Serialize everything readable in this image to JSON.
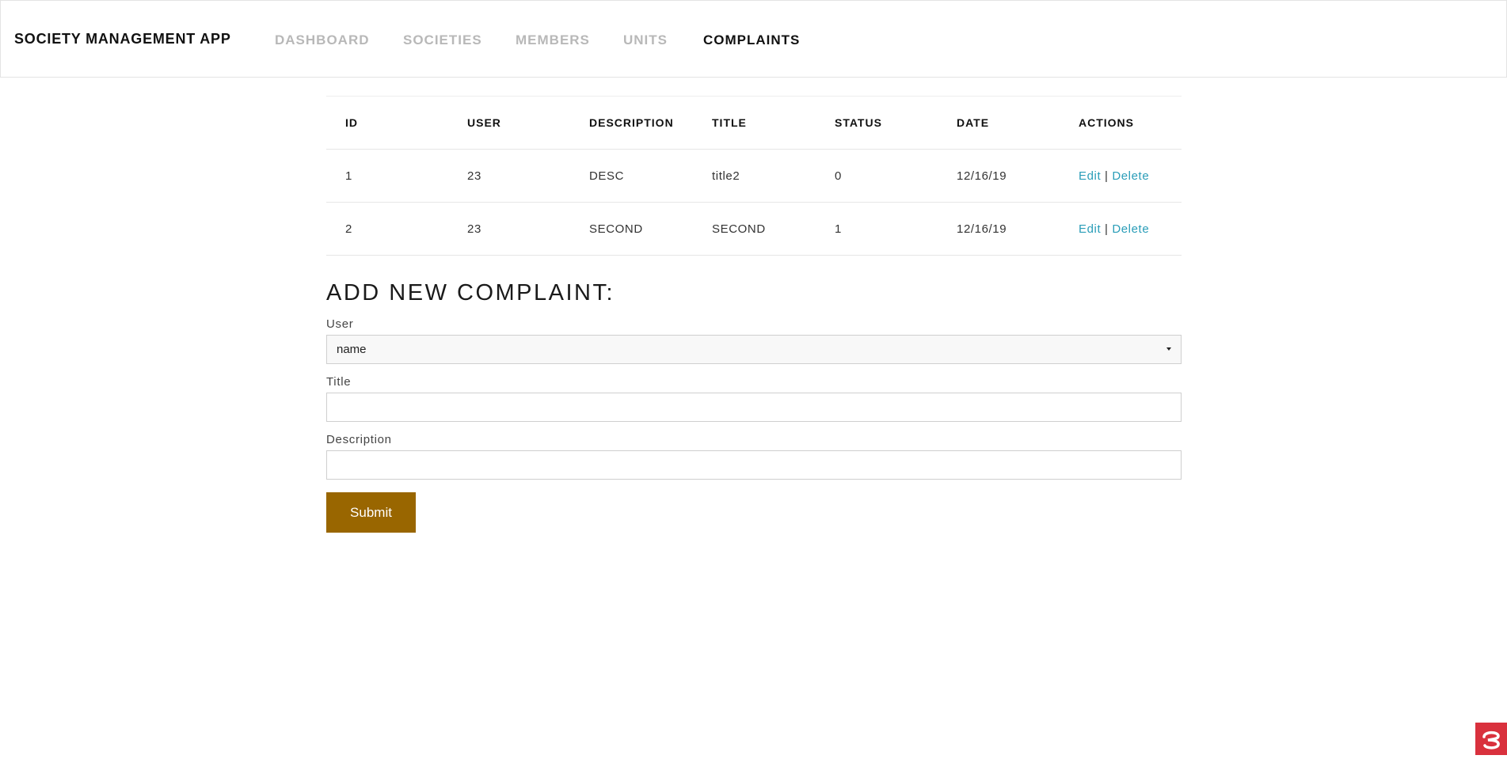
{
  "app": {
    "brand": "SOCIETY MANAGEMENT APP"
  },
  "nav": {
    "items": [
      {
        "label": "DASHBOARD",
        "active": false
      },
      {
        "label": "SOCIETIES",
        "active": false
      },
      {
        "label": "MEMBERS",
        "active": false
      },
      {
        "label": "UNITS",
        "active": false
      },
      {
        "label": "COMPLAINTS",
        "active": true
      }
    ]
  },
  "table": {
    "headers": [
      "ID",
      "USER",
      "DESCRIPTION",
      "TITLE",
      "STATUS",
      "DATE",
      "ACTIONS"
    ],
    "rows": [
      {
        "id": "1",
        "user": "23",
        "description": "DESC",
        "title": "title2",
        "status": "0",
        "date": "12/16/19"
      },
      {
        "id": "2",
        "user": "23",
        "description": "SECOND",
        "title": "SECOND",
        "status": "1",
        "date": "12/16/19"
      }
    ],
    "actions": {
      "edit": "Edit",
      "separator": "|",
      "delete": "Delete"
    }
  },
  "form": {
    "title": "ADD NEW COMPLAINT:",
    "user_label": "User",
    "user_selected": "name",
    "title_label": "Title",
    "title_value": "",
    "description_label": "Description",
    "description_value": "",
    "submit_label": "Submit"
  },
  "colors": {
    "accent_link": "#2a9db8",
    "submit_bg": "#996600",
    "nav_inactive": "#b8b8b8",
    "corner_badge": "#d9313d"
  },
  "icons": {
    "corner_badge": "logo-badge-icon",
    "select_caret": "caret-down-icon"
  }
}
